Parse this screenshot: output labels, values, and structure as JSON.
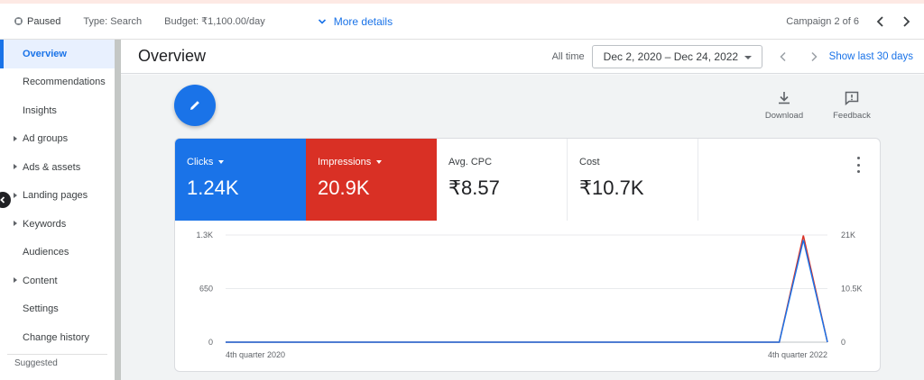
{
  "topbar": {
    "status": "Paused",
    "type": "Type: Search",
    "budget": "Budget: ₹1,100.00/day",
    "more_details": "More details",
    "campaign_count": "Campaign 2 of 6"
  },
  "sidebar": {
    "items": [
      {
        "label": "Overview",
        "active": true,
        "expandable": false
      },
      {
        "label": "Recommendations",
        "active": false,
        "expandable": false
      },
      {
        "label": "Insights",
        "active": false,
        "expandable": false
      },
      {
        "label": "Ad groups",
        "active": false,
        "expandable": true
      },
      {
        "label": "Ads & assets",
        "active": false,
        "expandable": true
      },
      {
        "label": "Landing pages",
        "active": false,
        "expandable": true
      },
      {
        "label": "Keywords",
        "active": false,
        "expandable": true
      },
      {
        "label": "Audiences",
        "active": false,
        "expandable": false
      },
      {
        "label": "Content",
        "active": false,
        "expandable": true
      },
      {
        "label": "Settings",
        "active": false,
        "expandable": false
      },
      {
        "label": "Change history",
        "active": false,
        "expandable": false
      }
    ],
    "suggested": "Suggested"
  },
  "header": {
    "title": "Overview",
    "all_time": "All time",
    "date_range": "Dec 2, 2020 – Dec 24, 2022",
    "show_last": "Show last 30 days"
  },
  "tools": {
    "download": "Download",
    "feedback": "Feedback"
  },
  "metrics": [
    {
      "label": "Clicks",
      "value": "1.24K",
      "dropdown": true,
      "color": "#1a73e8"
    },
    {
      "label": "Impressions",
      "value": "20.9K",
      "dropdown": true,
      "color": "#d93025"
    },
    {
      "label": "Avg. CPC",
      "value": "₹8.57",
      "dropdown": false
    },
    {
      "label": "Cost",
      "value": "₹10.7K",
      "dropdown": false
    }
  ],
  "chart_data": {
    "type": "line",
    "x": [
      "4th quarter 2020",
      "4th quarter 2022"
    ],
    "series": [
      {
        "name": "Clicks",
        "axis": "left",
        "color": "#1a73e8",
        "values": [
          0,
          0,
          0,
          0,
          0,
          0,
          0,
          0,
          0,
          0,
          0,
          0,
          0,
          0,
          0,
          0,
          0,
          0,
          0,
          0,
          0,
          0,
          0,
          0,
          1240,
          0
        ]
      },
      {
        "name": "Impressions",
        "axis": "right",
        "color": "#d93025",
        "values": [
          0,
          0,
          0,
          0,
          0,
          0,
          0,
          0,
          0,
          0,
          0,
          0,
          0,
          0,
          0,
          0,
          0,
          0,
          0,
          0,
          0,
          0,
          0,
          0,
          20900,
          0
        ]
      }
    ],
    "ylim_left": [
      0,
      1300
    ],
    "ylim_right": [
      0,
      21000
    ],
    "yticks_left": [
      "1.3K",
      "650",
      "0"
    ],
    "yticks_right": [
      "21K",
      "10.5K",
      "0"
    ],
    "grid": true
  }
}
